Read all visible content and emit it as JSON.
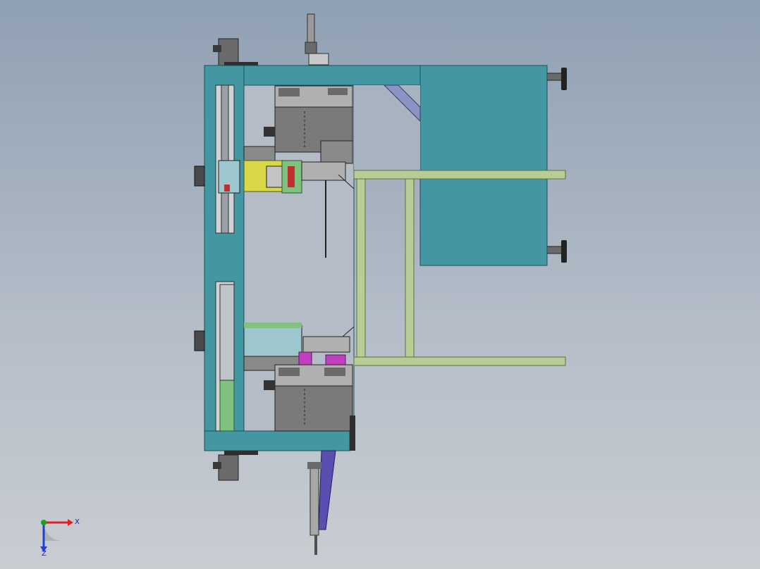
{
  "viewport": {
    "background_top": "#8fa0b3",
    "background_bottom": "#c9cdd2"
  },
  "colors": {
    "frame_teal": "#4397a3",
    "frame_edge": "#1d4f57",
    "rail_olive": "#b8cc96",
    "rail_edge": "#5e6f44",
    "machine_gray": "#7a7a7a",
    "machine_light": "#a8a8a8",
    "yellow_part": "#d8d846",
    "green_part": "#7fc27f",
    "magenta_part": "#c040c0",
    "violet_plate": "#5a4fb0",
    "axis_x": "#e02020",
    "axis_y": "#20a020",
    "axis_z": "#2040d0"
  },
  "triad": {
    "x_label": "X",
    "z_label": "Z"
  }
}
